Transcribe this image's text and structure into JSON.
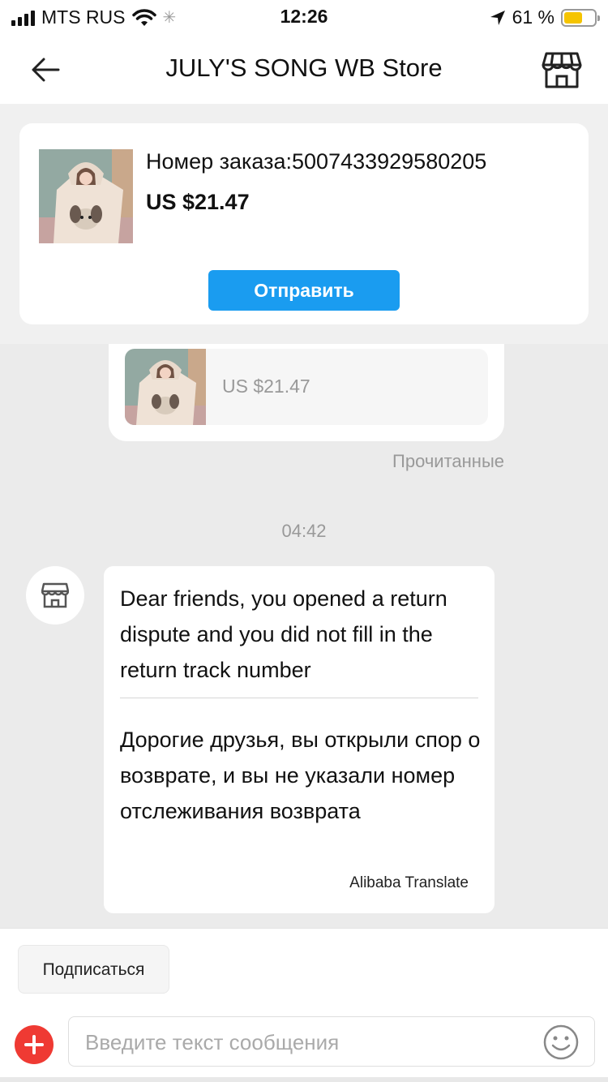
{
  "status_bar": {
    "carrier": "MTS RUS",
    "time": "12:26",
    "battery": "61 %",
    "battery_level": 0.61,
    "icons": [
      "signal-icon",
      "wifi-icon",
      "activity-spinner-icon",
      "location-arrow-icon",
      "battery-icon"
    ]
  },
  "header": {
    "title": "JULY'S SONG WB Store",
    "back_icon": "back-arrow-icon",
    "store_icon": "store-icon"
  },
  "order_card": {
    "order_number": "Номер заказа:5007433929580205",
    "price": "US $21.47",
    "send_button": "Отправить"
  },
  "messages": {
    "product": {
      "price": "US $21.47"
    },
    "read_status": "Прочитанные",
    "timestamp": "04:42",
    "seller": {
      "avatar_icon": "store-awning-icon",
      "text_en": "Dear friends, you opened a return dispute and you did not fill in the return track number",
      "text_ru": "Дорогие друзья, вы открыли спор о возврате, и вы не указали номер отслеживания возврата",
      "translation_label": "Alibaba Translate"
    }
  },
  "bottom": {
    "subscribe_button": "Подписаться",
    "input_placeholder": "Введите текст сообщения",
    "plus_icon": "plus-icon",
    "emoji_icon": "emoji-smile-icon"
  },
  "colors": {
    "accent": "#1a9cf0",
    "plus": "#ef3a33",
    "battery": "#f5c400"
  }
}
